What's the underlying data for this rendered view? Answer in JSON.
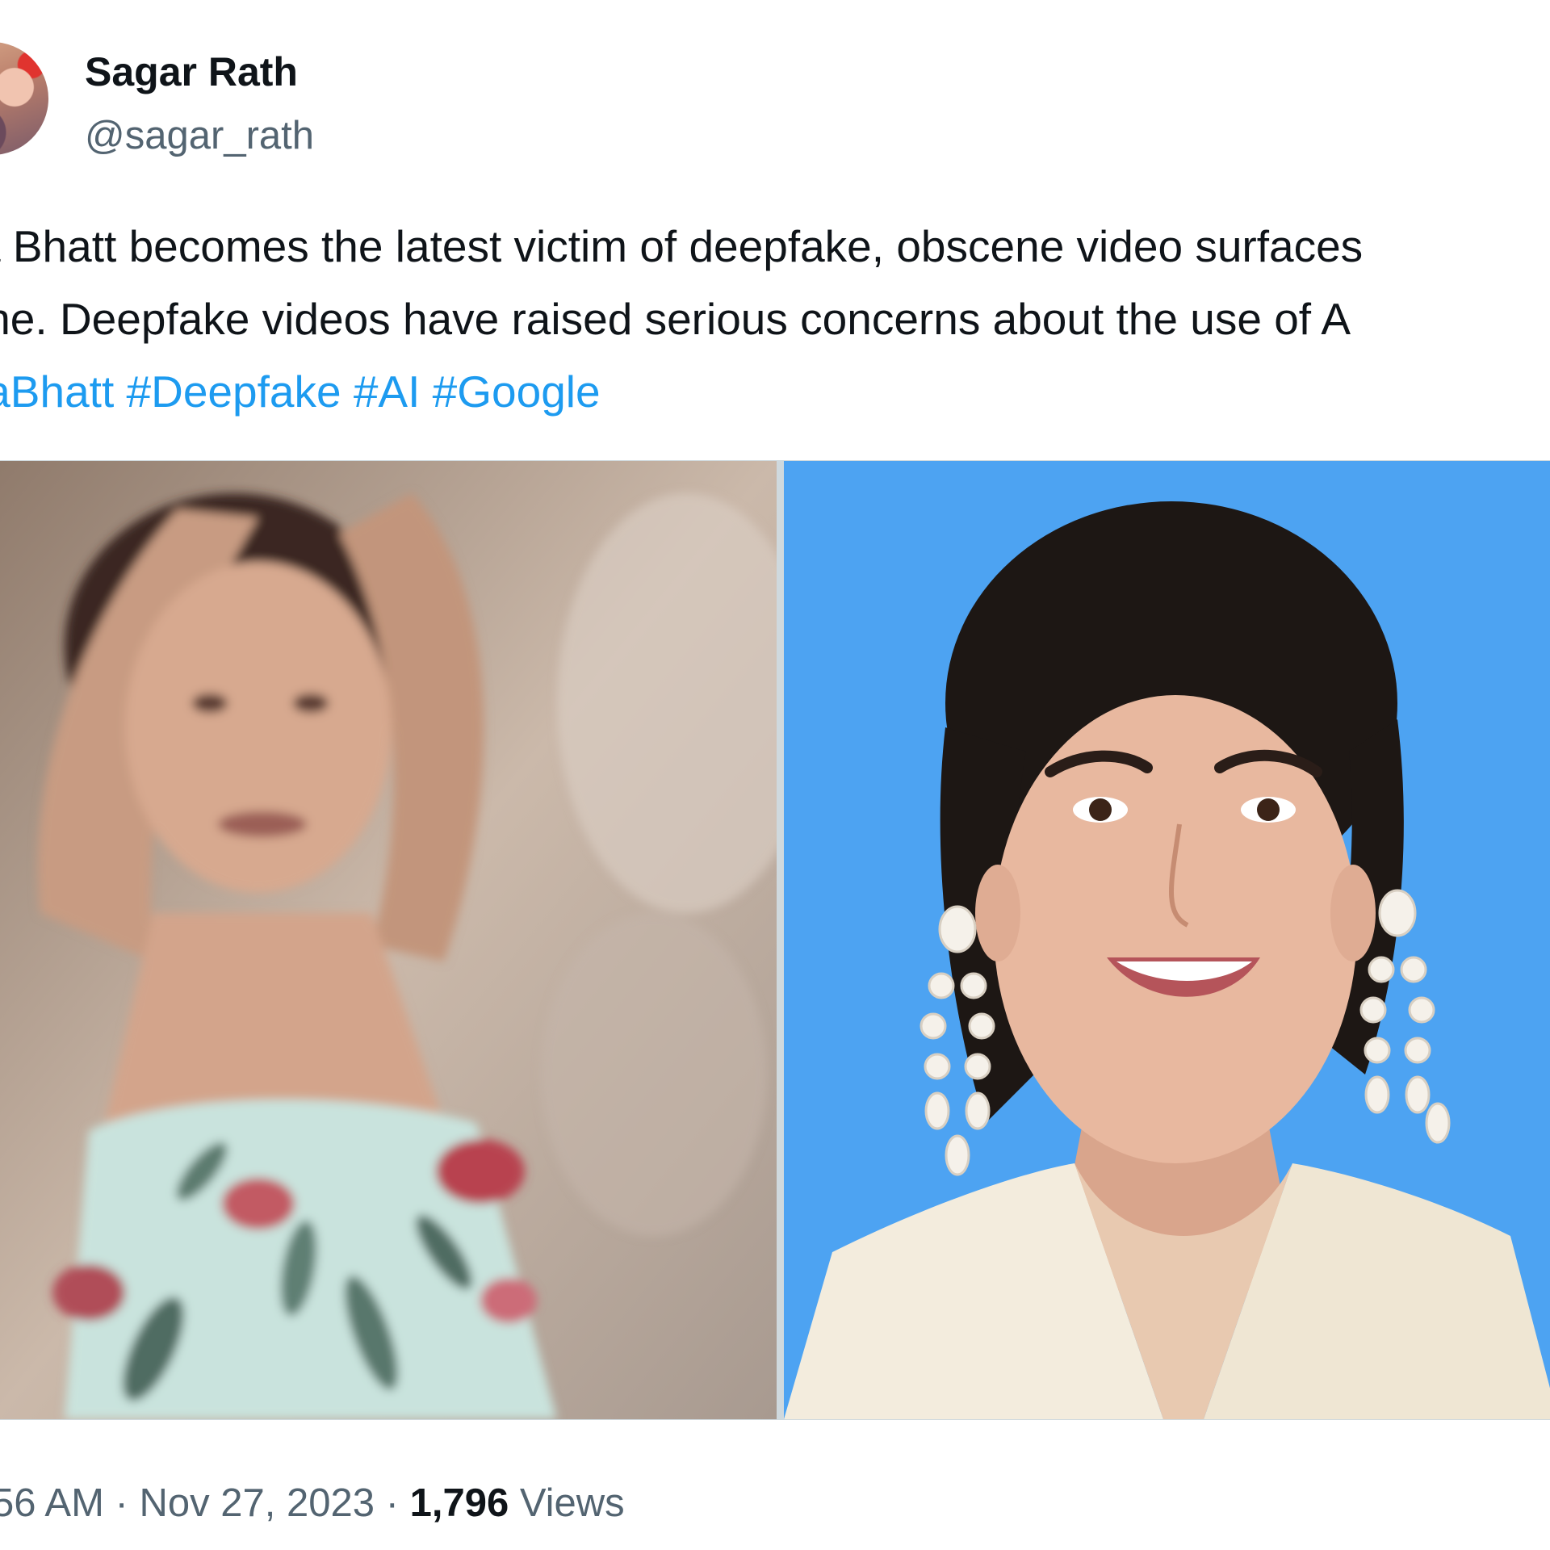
{
  "tweet": {
    "display_name": "Sagar Rath",
    "handle": "@sagar_rath",
    "text_line1": "a Bhatt becomes the latest victim of deepfake, obscene video surfaces",
    "text_line2": "ine. Deepfake videos have raised serious concerns about the use of A",
    "hashtags": [
      "iaBhatt",
      "#Deepfake",
      "#AI",
      "#Google"
    ],
    "time_fragment": "56 AM",
    "separator": "·",
    "date": "Nov 27, 2023",
    "views_count": "1,796",
    "views_label": "Views"
  },
  "colors": {
    "link": "#1d9bf0",
    "secondary_text": "#536471",
    "primary_text": "#0f1419",
    "right_photo_background": "#4da3f2"
  }
}
